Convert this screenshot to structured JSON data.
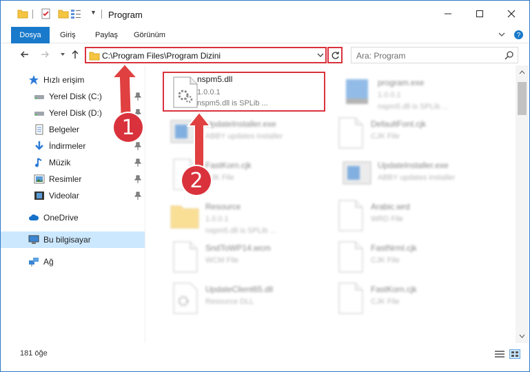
{
  "window": {
    "title": "Program",
    "controls": {
      "minimize": "minimize-icon",
      "maximize": "maximize-icon",
      "close": "close-icon"
    }
  },
  "ribbon": {
    "tabs": [
      {
        "label": "Dosya",
        "active": true
      },
      {
        "label": "Giriş"
      },
      {
        "label": "Paylaş"
      },
      {
        "label": "Görünüm"
      }
    ]
  },
  "nav": {
    "address": "C:\\Program Files\\Program Dizini",
    "search_placeholder": "Ara: Program"
  },
  "sidebar": {
    "items": [
      {
        "label": "Hızlı erişim",
        "icon": "star-icon"
      },
      {
        "label": "Yerel Disk (C:)",
        "icon": "drive-icon",
        "pinned": true
      },
      {
        "label": "Yerel Disk (D:)",
        "icon": "drive-icon",
        "pinned": true
      },
      {
        "label": "Belgeler",
        "icon": "documents-icon",
        "pinned": true
      },
      {
        "label": "İndirmeler",
        "icon": "download-icon",
        "pinned": true
      },
      {
        "label": "Müzik",
        "icon": "music-icon",
        "pinned": true
      },
      {
        "label": "Resimler",
        "icon": "pictures-icon",
        "pinned": true
      },
      {
        "label": "Videolar",
        "icon": "videos-icon",
        "pinned": true
      },
      {
        "label": "OneDrive",
        "icon": "cloud-icon"
      },
      {
        "label": "Bu bilgisayar",
        "icon": "computer-icon",
        "selected": true
      },
      {
        "label": "Ağ",
        "icon": "network-icon"
      }
    ]
  },
  "files": [
    {
      "name": "nspm5.dll",
      "line2": "1.0.0.1",
      "line3": "nspm5.dll is SPLib ...",
      "icon": "dll-icon",
      "highlighted": true
    },
    {
      "name": "program.exe",
      "line2": "1.0.0.1",
      "line3": "nspm5.dll is SPLib ...",
      "icon": "exe-icon"
    },
    {
      "name": "UpdateInstaller.exe",
      "line2": "ABBY updates installer",
      "line3": "",
      "icon": "installer-icon"
    },
    {
      "name": "DefaultFont.cjk",
      "line2": "CJK File",
      "line3": "",
      "icon": "file-icon"
    },
    {
      "name": "FastKorn.cjk",
      "line2": "CJK File",
      "line3": "",
      "icon": "file-icon"
    },
    {
      "name": "UpdateInstaller.exe",
      "line2": "ABBY updates installer",
      "line3": "",
      "icon": "installer-icon"
    },
    {
      "name": "Resource",
      "line2": "1.0.0.1",
      "line3": "nspm5.dll is SPLib ...",
      "icon": "folder-icon"
    },
    {
      "name": "Arabic.wrd",
      "line2": "WRD File",
      "line3": "",
      "icon": "file-icon"
    },
    {
      "name": "SndToWP14.wcm",
      "line2": "WCM File",
      "line3": "",
      "icon": "file-icon"
    },
    {
      "name": "FastNrml.cjk",
      "line2": "CJK File",
      "line3": "",
      "icon": "file-icon"
    },
    {
      "name": "UpdateClient65.dll",
      "line2": "Resource DLL",
      "line3": "",
      "icon": "dll-icon"
    },
    {
      "name": "FastKorn.cjk",
      "line2": "CJK File",
      "line3": "",
      "icon": "file-icon"
    }
  ],
  "status": {
    "count": "181 öğe"
  },
  "annotations": [
    {
      "label": "1",
      "color": "#d9323c"
    },
    {
      "label": "2",
      "color": "#d9323c"
    }
  ]
}
